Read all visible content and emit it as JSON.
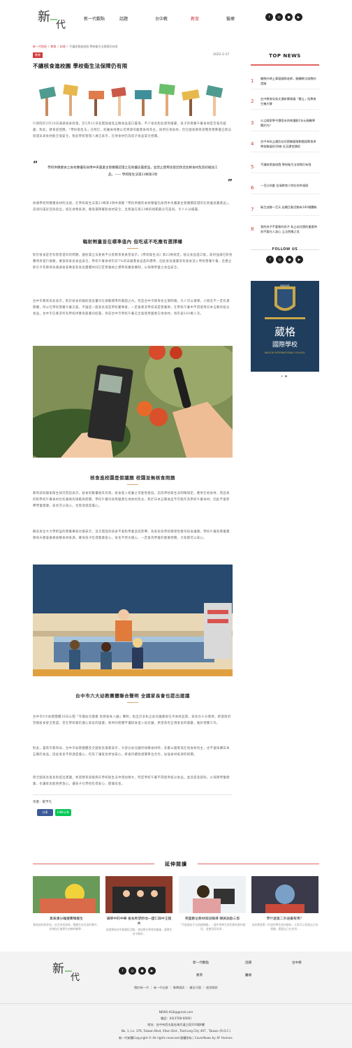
{
  "brand": {
    "logo_text": "新一代"
  },
  "nav": [
    "新一代觀點",
    "話題",
    "台中教",
    "教育",
    "醫療"
  ],
  "nav_active": 3,
  "social_icons": [
    "facebook-icon",
    "instagram-icon",
    "line-icon",
    "youtube-icon"
  ],
  "breadcrumb": {
    "home": "新一代首頁",
    "level1": "教育",
    "level2": "料理",
    "current": "不讓核食進校園 學校衛生法保障仍有限"
  },
  "article": {
    "tag": "教育",
    "date": "2022-2-17",
    "title": "不讓核食進校園 學校衛生法保障仍有限",
    "p1": "行政院於2月10日通過核食政策，於2月21日起開放福島五縣食品進口臺灣，不少家長對此感到擔憂，孩子的營養午餐食材是否會有疑慮，對此，教育部回應，「學校衛生法」已明訂，校園食材應以可溯源的國產食材為主，採用在地食材，但在國家教育部簡易預算書已無法保證未來食材能全面安全，對此學校管理人員已表示，在地食材仍為孩子食品安全把關。",
    "quote": "學校供應膳食之食材應優先採用中央農業主管機關認證之在地優良農產品，並禁止使用含基因改造生鮮食材及其初級加工品。—— 學校衛生法第23條第3項",
    "p2": "依據學校供應膳食材的法規，在學校衛生法第23條第3項中規範「學校供膳的食材應優先採用中央農業主管機關認證的在地優良農產品」，其如同滿足這與與出，接近食物來源，確保選擇餐點食材安全，且無論在第23條的規範最分完美與，令人十分擔憂。",
    "h1": "輻射劑量皆在標準值內 但吃或不吃應有選擇權",
    "p3": "對於核食是否有無害進料的問題，國民黨立法委員不分區教育委員曾表示，《學校衛生法》第23條規定，核災食品進口後，政府強調已對各種項目進行檢驗，確保與家長食品安全，學校午餐食材仍有7%的非國產食品進料標準，因此家長擔憂恐有核食流入學校營養午餐，且應立即在今年教育局邀請食安專家及家長團體共同訂定更嚴格之標準與審查機制，以保障學童之食品安全。",
    "p4": "台中市教育局長表示，對於核食的輻射值含量均在規範標準的範圍之內，但是台中市教育局立場明確，大人可以選擇，小朋友不一定有選擇權，所以在學校營養午餐方面，不論是一般家長或是學校董事會，一定會要求學校或是營養師，在學校午餐中不得使用日本五縣的核災食品，台中市已要求所有學校供應商簽署切結書，目前台中市學校午餐已全面使用國產在地食材，每年逾100萬人次。",
    "h2": "核食進校園是假議題 校園並無核食問題",
    "p5": "教育部與國家衛生研究院前表示，核食的數量極其有限，核食進入校園之可能性極低，因為學校衛生法明確規定，應用在地食材，而且政府對學校午餐食材也有嚴格的規範與把關，學校午餐均採用國產在地食材為主，對於日本五縣食品不可能作為學校午餐食材，因此不會影響學童健康，家長可以放心，也無須過度擔心。",
    "p6": "縣長與台大大學附設的營養專家也都表示，這次開放的核食不會對學童造成影響，各家長與學校應理性看待核食議題，學校午餐與營養團隊每天都會嚴格檢驗食材來源，確保孩子吃得健康安心，家長不用太擔心，一定會為學童的健康把關，大家都可以安心。",
    "h3": "台中市六大幼教團體聯合聲明 全國家長會也提出建議",
    "p7": "台中市6大幼教團體16日公開「守護幼兒健康 拒絕核食入園」聲明，指出許多私立幼兒園都很在乎食材品質，家長也十分重視，即使政府宣稱核食安全無虞，但在學校端仍擔心家長的疑慮，將共同把關不讓核食進入幼兒園，希望政府正視家長的擔憂，做好把關工作。",
    "p8": "對此，臺南市教育局、台中市幼教團體及全國家長會都表示，大部分幼兒園所採購食材時，多數以國產或在地食材為主，也不會採購日本五縣的食品，因此家長不用過度擔心，但為了讓家長更加安心，將會持續與相關單位合作，加強食材來源的把關。",
    "p9": "而全國家長會長則提出建議，希望教育部能夠在學校衛生法中增加條文，明定學校午餐不得使用核災食品，並且提高罰則，以保障學童健康，也讓家長能夠更放心，讓孩子在學校吃得安心、健康成長。",
    "author": "作者：蔡予凡",
    "share_fb": "分享",
    "share_line": "LINE分享"
  },
  "sidebar": {
    "heading": "TOP NEWS",
    "news": [
      {
        "num": "1",
        "text": "雙胞外師上華德國際老師，翻轉教法發教的證據"
      },
      {
        "num": "2",
        "text": "台中教育局長文遺新賽建議「嬰立」拓教育生機大賽"
      },
      {
        "num": "3",
        "text": "公立國家學子讀稻未與來鐘點1年元服醫學關於內？"
      },
      {
        "num": "4",
        "text": "台中市私立國民幼兒園聯盟推動閩語教育與學校聯展的30幾 近這課堂課程"
      },
      {
        "num": "5",
        "text": "不讓核食進校園 學校衛生法保障仍有限"
      },
      {
        "num": "6",
        "text": "一百分的重 台灣教育少院在的幸福感"
      },
      {
        "num": "7",
        "text": "衛生部腳一百天 延續互動活動有100場體驗"
      },
      {
        "num": "8",
        "text": "我的孩子不要像的孩子 私立幼兒園的重要時刻不要在人身心 立法院應之見"
      }
    ],
    "follow": "FOLLOW US",
    "ad_school_en": "WAGOR",
    "ad_title": "葳格",
    "ad_sub": "國際學校",
    "ad_en": "WAGOR INTERNATIONAL SCHOOL"
  },
  "related": {
    "heading": "延伸閱讀",
    "items": [
      {
        "title": "資表課分離遷賽輝覺生",
        "desc": "教育部的與家長，這天完成東南，關鍵生長內容的事件，並增加日後學生的教師教學..."
      },
      {
        "title": "講師中的中華 會長希望跨地一國仁興中王趨共",
        "desc": "這個學校的中華課程活動，增加學生學習的機會，讓學生在中華的..."
      },
      {
        "title": "英國數位教材如說報導 購買與歐三思",
        "desc": "「不能讓孩子太依賴網路」，國中與學生對於教科書的使用，並使用家長與..."
      },
      {
        "title": "學什麼第二外語最有用？",
        "desc": "這些學習第二外語的學生每年都有，大家可以找到自己的興趣，看看自己在台灣..."
      }
    ]
  },
  "footer": {
    "links_right": [
      "新一代觀點",
      "話題",
      "台中教",
      "教育",
      "醫療"
    ],
    "links_mid": "關於新一代 ｜ 新一代社群 ｜ 徵聘資訊 ｜ 廣告刊登 ｜ 使用條款",
    "email": "NEWS-AGE@gmail.com",
    "phone": "電話：04(3708-6000)",
    "address_zh": "地址：台中市西屯區台灣大道三段316號8樓",
    "address_en": "No. 1, Ln. 376, Taiwan Blvd, Xitun Dist., Taichung City 407 , Taiwan (R.O.C.)",
    "copyright": "新一代新聞Copyright © All rights reserved.版權所有 | CoverNews by AF themes."
  },
  "colors": {
    "accent": "#d23b3b",
    "gold": "#d9a36c",
    "ad_bg": "#1f3d5c"
  }
}
